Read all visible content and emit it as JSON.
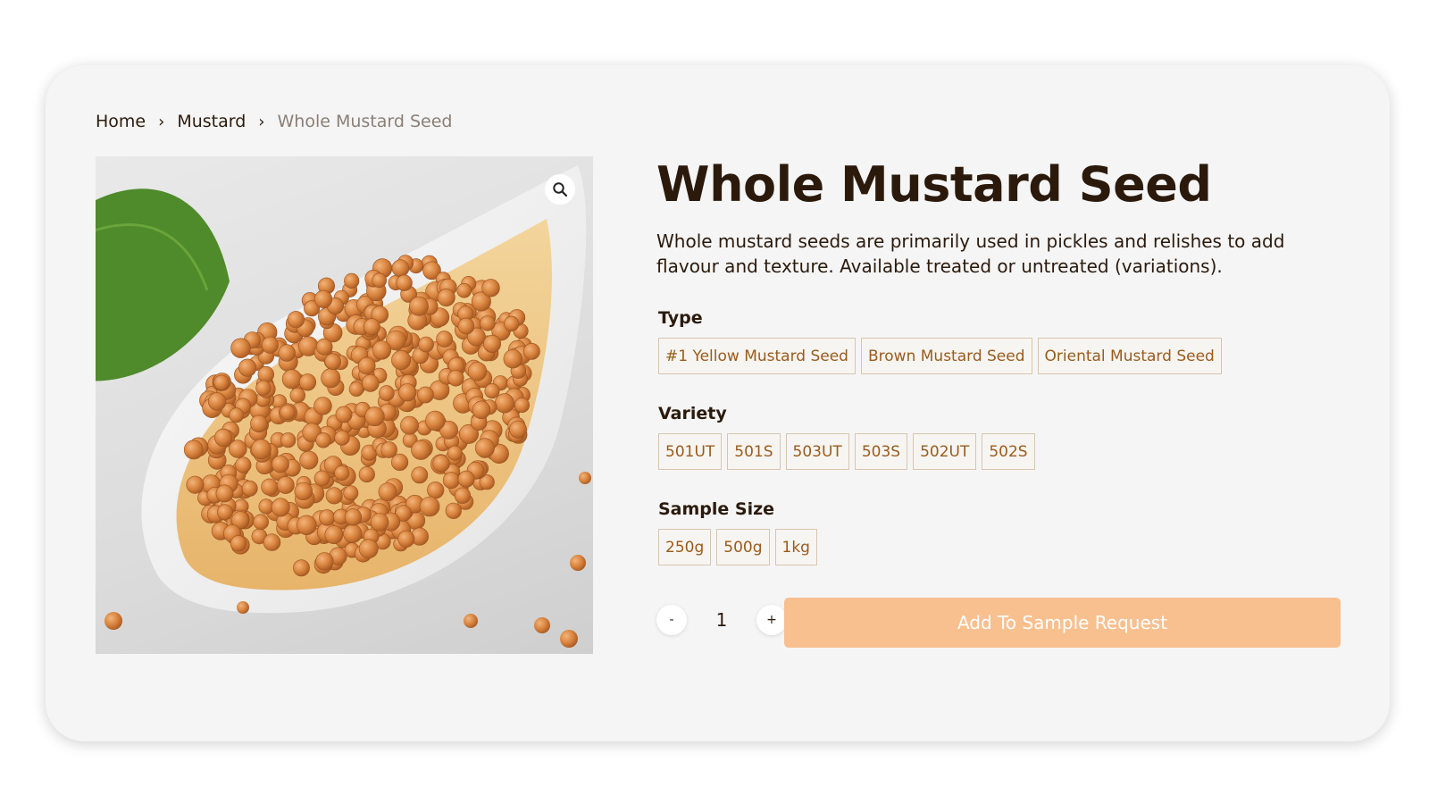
{
  "breadcrumb": {
    "items": [
      "Home",
      "Mustard"
    ],
    "current": "Whole Mustard Seed"
  },
  "product": {
    "title": "Whole Mustard Seed",
    "description": "Whole mustard seeds are primarily used in pickles and relishes to add flavour and texture. Available treated or untreated (variations).",
    "image_icon": "zoom-icon"
  },
  "options": {
    "type": {
      "label": "Type",
      "values": [
        "#1 Yellow Mustard Seed",
        "Brown Mustard Seed",
        "Oriental Mustard Seed"
      ]
    },
    "variety": {
      "label": "Variety",
      "values": [
        "501UT",
        "501S",
        "503UT",
        "503S",
        "502UT",
        "502S"
      ]
    },
    "sample_size": {
      "label": "Sample Size",
      "values": [
        "250g",
        "500g",
        "1kg"
      ]
    }
  },
  "quantity": {
    "decrement": "-",
    "value": "1",
    "increment": "+"
  },
  "cta": {
    "label": "Add To Sample Request"
  },
  "colors": {
    "text": "#2b1a0c",
    "swatch_text": "#9a5b1c",
    "cta_bg": "#f9c08f",
    "card_bg": "#f5f5f5"
  }
}
